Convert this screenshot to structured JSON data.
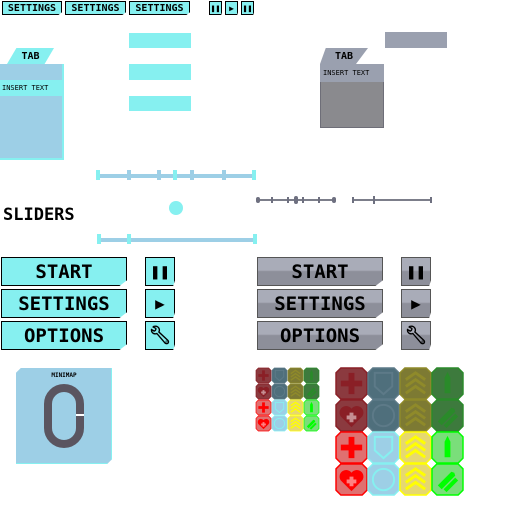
{
  "top_bar": {
    "settings_buttons": [
      "SETTINGS",
      "SETTINGS",
      "SETTINGS"
    ],
    "icons": [
      "pause-icon",
      "play-icon",
      "pause-icon"
    ]
  },
  "tab_panel_cyan": {
    "tab_label": "TAB",
    "insert_text": "INSERT TEXT"
  },
  "tab_panel_gray": {
    "tab_label": "TAB",
    "insert_text": "INSERT TEXT"
  },
  "sliders_label": "SLIDERS",
  "menu_cyan": {
    "buttons": [
      "START",
      "SETTINGS",
      "OPTIONS"
    ],
    "icons": [
      "pause-icon",
      "play-icon",
      "wrench-icon"
    ]
  },
  "menu_gray": {
    "buttons": [
      "START",
      "SETTINGS",
      "OPTIONS"
    ],
    "icons": [
      "pause-icon",
      "play-icon",
      "wrench-icon"
    ]
  },
  "minimap": {
    "label": "MINIMAP"
  },
  "colors": {
    "cyan": "#86f0f0",
    "light_blue": "#9dcfe6",
    "gray": "#9aa0af",
    "dark_gray": "#8a8a8e",
    "track": "#5a5560"
  },
  "powerups": {
    "columns": [
      {
        "dark_bg": "#8b3a3f",
        "dark_fg": "#8a1f26",
        "bright_bg": "#e07070",
        "bright_fg": "#ff0000",
        "icons": [
          "cross-icon",
          "heart-icon"
        ]
      },
      {
        "dark_bg": "#4f6f7c",
        "dark_fg": "#5d7a88",
        "bright_bg": "#9dcfe6",
        "bright_fg": "#86f0f0",
        "icons": [
          "shield-icon",
          "circle-icon"
        ]
      },
      {
        "dark_bg": "#7d7a33",
        "dark_fg": "#8f8a2a",
        "bright_bg": "#e6d870",
        "bright_fg": "#ffff00",
        "icons": [
          "chevrons-icon",
          "chevrons-icon"
        ]
      },
      {
        "dark_bg": "#3d7a3d",
        "dark_fg": "#2a8a2a",
        "bright_bg": "#7ade7a",
        "bright_fg": "#00ff00",
        "icons": [
          "bullet-icon",
          "bullets-icon"
        ]
      }
    ]
  }
}
